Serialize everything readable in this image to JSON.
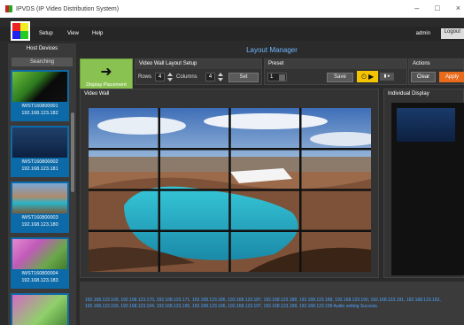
{
  "window": {
    "title": "IPVDS (IP Video Distribution System)",
    "minimize": "–",
    "maximize": "□",
    "close": "×"
  },
  "menu": {
    "setup": "Setup",
    "view": "View",
    "help": "Help",
    "user": "admin",
    "logout": "Logout"
  },
  "sidebar": {
    "header": "Host Devices",
    "search": "Searching",
    "devices": [
      {
        "name": "IWST160800001",
        "ip": "192.168.123.182"
      },
      {
        "name": "IWST160800002",
        "ip": "192.168.123.181"
      },
      {
        "name": "IWST160800003",
        "ip": "192.168.123.180"
      },
      {
        "name": "IWST160800004",
        "ip": "192.168.123.183"
      }
    ]
  },
  "layout_manager": {
    "title": "Layout Manager",
    "display_placement": "Display Placement",
    "setup": {
      "title": "Video Wall Layout Setup",
      "rows_label": "Rows",
      "rows": "4",
      "cols_label": "Columns",
      "cols": "4",
      "set": "Set"
    },
    "preset": {
      "title": "Preset",
      "value": "1",
      "save": "Save"
    },
    "actions": {
      "title": "Actions",
      "clear": "Clear",
      "apply": "Apply"
    }
  },
  "video_wall": {
    "title": "Video Wall",
    "rows": 4,
    "cols": 4
  },
  "individual_display": {
    "title": "Individual Display"
  },
  "log": {
    "text": "192.168.123.100, 192.168.123.170, 192.168.123.171, 192.168.123.186, 192.168.123.187, 192.168.123.188, 192.168.123.189, 192.168.123.190, 192.168.123.191, 192.168.123.192, 192.168.123.193, 192.168.123.194, 192.168.123.195, 192.168.123.196, 192.168.123.197, 192.168.123.198, 192.168.123.199 Audio setting Success."
  },
  "colors": {
    "accent_blue": "#0d6aa8",
    "apply": "#e86a1a",
    "play": "#f5c400",
    "placement": "#8ac251"
  }
}
